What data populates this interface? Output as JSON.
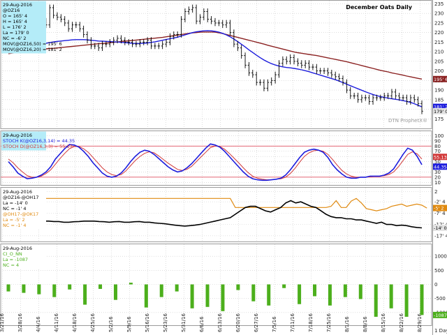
{
  "header": {
    "title": "December Oats Daily",
    "watermark": "DTN ProphetX®"
  },
  "footer": {
    "interval": "1 Day"
  },
  "colors": {
    "price": "#000000",
    "ma_long": "#8b2222",
    "ma_short": "#1c1cdd",
    "stoch_k": "#1c1cdd",
    "stoch_d": "#d23a3a",
    "ref_line": "#e05060",
    "spread_a": "#000000",
    "spread_b": "#e08a10",
    "cot_bar": "#4caf1c",
    "legend_bg": "#b4ecf8",
    "grid": "#c9c9c9"
  },
  "chart_data": [
    {
      "type": "ohlc",
      "panel": "price",
      "legend": [
        "29-Aug-2016",
        "@OZ16",
        "O = 165' 4",
        "H = 165' 4",
        "L = 176' 2",
        "La = 179' 0",
        "NC = -6' 2",
        "MOV(@OZ16,50) = 195' 6",
        "MOV(@OZ16,20) = 181' 2"
      ],
      "x_ticks": [
        "3/21/16",
        "3/28/16",
        "4/4/16",
        "4/11/16",
        "4/18/16",
        "4/25/16",
        "5/2/16",
        "5/9/16",
        "5/16/16",
        "5/23/16",
        "5/31/16",
        "6/6/16",
        "6/13/16",
        "6/20/16",
        "6/27/16",
        "7/5/16",
        "7/11/16",
        "7/18/16",
        "7/25/16",
        "8/1/16",
        "8/8/16",
        "8/15/16",
        "8/22/16",
        "8/29/16"
      ],
      "y_ticks": [
        175,
        180,
        185,
        190,
        195,
        200,
        205,
        210,
        215,
        220,
        225,
        230,
        235
      ],
      "ylim": [
        170,
        237
      ],
      "tags": [
        {
          "label": "195' 6",
          "value": 195.75
        },
        {
          "label": "181' 2",
          "value": 181.25
        },
        {
          "label": "179' 0",
          "value": 179.0
        }
      ],
      "close": [
        211.5,
        211.5,
        211,
        212.5,
        213,
        212,
        214,
        216,
        219,
        226,
        224,
        233,
        229,
        228,
        227,
        225,
        222,
        224,
        224,
        222,
        219,
        216,
        213,
        213,
        212,
        214,
        214,
        215,
        216,
        217,
        216,
        215,
        215,
        214,
        214,
        215,
        215,
        216,
        213,
        213,
        213,
        214,
        215,
        218,
        219,
        219,
        227,
        231,
        232,
        233,
        226,
        228,
        231,
        227,
        226,
        225,
        225,
        224,
        225,
        220,
        214,
        212,
        208,
        203,
        199,
        198,
        194,
        194,
        191,
        194,
        195,
        198,
        204,
        206,
        205,
        207,
        205,
        204,
        203,
        204,
        202,
        202,
        200,
        200,
        200,
        199,
        198,
        197,
        196,
        194,
        190,
        187,
        187,
        185,
        186,
        186,
        184,
        186,
        186,
        186,
        187,
        187,
        189,
        187,
        186,
        186,
        184,
        186,
        185,
        183,
        179
      ],
      "ma50": [
        209,
        209.3,
        209.5,
        209.7,
        209.9,
        210.1,
        210.4,
        210.7,
        211,
        211.3,
        211.5,
        211.7,
        211.8,
        212,
        212.2,
        212.4,
        212.6,
        212.8,
        213,
        213.2,
        213.4,
        213.6,
        213.8,
        214,
        214.2,
        214.3,
        214.5,
        214.7,
        214.9,
        215.1,
        215.3,
        215.5,
        215.7,
        215.9,
        216.1,
        216.3,
        216.5,
        216.7,
        216.9,
        217.1,
        217.3,
        217.5,
        217.8,
        218.1,
        218.4,
        218.7,
        219,
        219.3,
        219.6,
        219.9,
        220,
        220.2,
        220.3,
        220.3,
        220.3,
        220.2,
        219.9,
        219.5,
        219,
        218.5,
        218,
        217.5,
        217,
        216.5,
        216,
        215.5,
        215,
        214.5,
        214,
        213.4,
        212.9,
        212.4,
        211.9,
        211.4,
        210.9,
        210.4,
        209.9,
        209.5,
        209.2,
        208.9,
        208.6,
        208.3,
        208,
        207.6,
        207.2,
        206.8,
        206.4,
        206,
        205.6,
        205.2,
        204.8,
        204.3,
        203.8,
        203.3,
        202.8,
        202.3,
        201.8,
        201.3,
        200.8,
        200.3,
        199.9,
        199.5,
        199,
        198.6,
        198.2,
        197.8,
        197.3,
        196.9,
        196.5,
        196.1,
        195.75
      ],
      "ma20": [
        211.2,
        211.5,
        211.8,
        212,
        212.2,
        212.5,
        212.8,
        213.2,
        213.6,
        214,
        214.4,
        214.8,
        215.1,
        215.4,
        215.6,
        215.8,
        216,
        216.2,
        216.3,
        216.3,
        216.3,
        216.2,
        216,
        215.8,
        215.6,
        215.5,
        215.4,
        215.3,
        215.2,
        215.1,
        214.9,
        214.8,
        214.6,
        214.4,
        214.3,
        214.3,
        214.4,
        214.6,
        214.9,
        215.2,
        215.6,
        216,
        216.4,
        216.8,
        217.2,
        217.6,
        218.2,
        218.8,
        219.4,
        220,
        220.4,
        220.7,
        220.9,
        221,
        220.9,
        220.6,
        220.2,
        219.6,
        218.8,
        217.8,
        216.6,
        215.3,
        213.9,
        212.5,
        211,
        209.6,
        208.2,
        206.9,
        205.7,
        204.7,
        203.8,
        203.1,
        202.5,
        202.1,
        201.8,
        201.6,
        201.3,
        201,
        200.6,
        200.1,
        199.6,
        199,
        198.4,
        197.8,
        197.2,
        196.6,
        196,
        195.4,
        194.7,
        193.9,
        193.1,
        192.3,
        191.5,
        190.7,
        189.9,
        189.1,
        188.4,
        187.7,
        187.1,
        186.6,
        186.2,
        185.8,
        185.5,
        185.2,
        184.9,
        184.5,
        184.1,
        183.6,
        182.9,
        182.1,
        181.25
      ]
    },
    {
      "type": "line",
      "panel": "stochastic",
      "legend": [
        "29-Aug-2016",
        "STOCH K(@OZ16,3,14) = 44.35",
        "STOCH D(@OZ16,3,3) = 55.13"
      ],
      "y_ticks": [
        10,
        20,
        30,
        40,
        50,
        60,
        70,
        80,
        90,
        100
      ],
      "ylim": [
        5,
        110
      ],
      "ref_lines": [
        80,
        20
      ],
      "tags": [
        {
          "label": "55.13",
          "value": 55.13
        },
        {
          "label": "44.35",
          "value": 44.35
        }
      ],
      "series": [
        {
          "name": "STOCH K",
          "values": [
            50,
            40,
            28,
            22,
            17,
            18,
            20,
            24,
            30,
            40,
            55,
            65,
            75,
            83,
            82,
            78,
            70,
            60,
            48,
            38,
            28,
            22,
            20,
            22,
            28,
            38,
            50,
            60,
            68,
            72,
            70,
            64,
            56,
            48,
            40,
            34,
            30,
            32,
            38,
            46,
            56,
            66,
            76,
            84,
            82,
            78,
            70,
            60,
            50,
            40,
            30,
            22,
            17,
            15,
            14,
            14,
            15,
            16,
            18,
            24,
            34,
            46,
            58,
            68,
            72,
            74,
            72,
            68,
            58,
            44,
            34,
            26,
            20,
            18,
            18,
            20,
            20,
            22,
            22,
            22,
            24,
            28,
            36,
            50,
            64,
            76,
            72,
            60,
            44
          ]
        },
        {
          "name": "STOCH D",
          "values": [
            55,
            48,
            38,
            30,
            23,
            20,
            20,
            22,
            27,
            34,
            45,
            56,
            66,
            75,
            79,
            79,
            75,
            68,
            58,
            48,
            38,
            30,
            25,
            23,
            25,
            32,
            42,
            52,
            60,
            66,
            69,
            67,
            61,
            54,
            47,
            41,
            35,
            33,
            35,
            41,
            50,
            59,
            68,
            77,
            80,
            79,
            74,
            66,
            57,
            48,
            38,
            29,
            22,
            18,
            16,
            15,
            15,
            16,
            17,
            20,
            27,
            37,
            49,
            60,
            67,
            71,
            72,
            70,
            64,
            54,
            43,
            33,
            26,
            22,
            20,
            20,
            20,
            21,
            22,
            22,
            23,
            25,
            30,
            40,
            52,
            64,
            69,
            65,
            55.13
          ]
        }
      ]
    },
    {
      "type": "line",
      "panel": "spread",
      "legend": [
        "29-Aug-2016",
        "@OZ16-@OH17",
        "La = -14' 0",
        "NC = -1' 4",
        "@OH17-@OK17",
        "La = -5' 2",
        "NC = -1' 4"
      ],
      "y_ticks": [
        "2",
        "-2' 4",
        "-7' 4",
        "-12' 4",
        "-17' 4"
      ],
      "y_tick_values": [
        2,
        -2.5,
        -7.5,
        -12.5,
        -17.5
      ],
      "ylim": [
        -20,
        4
      ],
      "tags": [
        {
          "label": "-5' 2",
          "value": -5.25
        },
        {
          "label": "-14' 0",
          "value": -14.0
        }
      ],
      "series": [
        {
          "name": "@OZ16-@OH17",
          "values": [
            -6,
            -6.5,
            -7,
            -8,
            -9.5,
            -10,
            -10.5,
            -11,
            -11,
            -11.2,
            -11.2,
            -11.5,
            -11.5,
            -11.3,
            -11.2,
            -11,
            -11,
            -11,
            -11.2,
            -11.3,
            -11.5,
            -11.3,
            -11.2,
            -11.5,
            -11.5,
            -11.3,
            -11.2,
            -11.5,
            -11.5,
            -11.8,
            -12,
            -12.2,
            -12.5,
            -12.8,
            -13,
            -13.2,
            -13,
            -12.8,
            -12.5,
            -12,
            -11.5,
            -11,
            -10.5,
            -10,
            -9.5,
            -8,
            -6.5,
            -5,
            -4.5,
            -4.5,
            -5.5,
            -6.5,
            -7,
            -6,
            -5,
            -3,
            -2,
            -3,
            -2.5,
            -3.5,
            -4.5,
            -5,
            -6.5,
            -8,
            -9,
            -9.5,
            -9.5,
            -10,
            -10,
            -10.5,
            -10.5,
            -11,
            -11.5,
            -12,
            -11.5,
            -12.5,
            -12.5,
            -13,
            -12.8,
            -13,
            -13.5,
            -13.8,
            -14
          ]
        },
        {
          "name": "@OH17-@OK17",
          "values": [
            -1,
            -1,
            -1,
            -1,
            -1,
            -1,
            -1,
            -1,
            -1,
            -1,
            -1,
            -1,
            -1,
            -1,
            -1,
            -1,
            -1,
            -1,
            -1,
            -1,
            -1,
            -1,
            -1,
            -1,
            -1,
            -1,
            -1,
            -1,
            -1,
            -1,
            -1,
            -1,
            -1,
            -1,
            -1,
            -1,
            -1,
            -1,
            -1,
            -1,
            -1,
            -1,
            -1,
            -1,
            -1,
            -5,
            -5,
            -5,
            -5,
            -5,
            -5,
            -5,
            -5,
            -5,
            -5,
            -5,
            -5,
            -5,
            -5,
            -5,
            -5,
            -5,
            -5,
            -5,
            -4.5,
            -2,
            -5,
            -5,
            -2.2,
            -1,
            -3,
            -5.5,
            -6,
            -6.5,
            -6,
            -5.5,
            -4.5,
            -4,
            -3.5,
            -4.5,
            -4,
            -3.5,
            -4,
            -5.25
          ]
        }
      ]
    },
    {
      "type": "bar",
      "panel": "cot",
      "legend": [
        "29-Aug-2016",
        "CI_O_NN",
        "La = -1087",
        "NC = 4"
      ],
      "y_ticks": [
        1000,
        500,
        0,
        -500,
        -1000
      ],
      "ylim": [
        -1450,
        1450
      ],
      "tags": [
        {
          "label": "-1087",
          "value": -1087
        }
      ],
      "values": [
        -250,
        -300,
        -350,
        -450,
        -180,
        -720,
        -160,
        -550,
        60,
        -820,
        -450,
        -250,
        -850,
        -800,
        -950,
        -200,
        -600,
        -750,
        -130,
        -700,
        -420,
        -750,
        -450,
        -520,
        -1150,
        -850,
        -1150,
        -1087
      ]
    }
  ]
}
